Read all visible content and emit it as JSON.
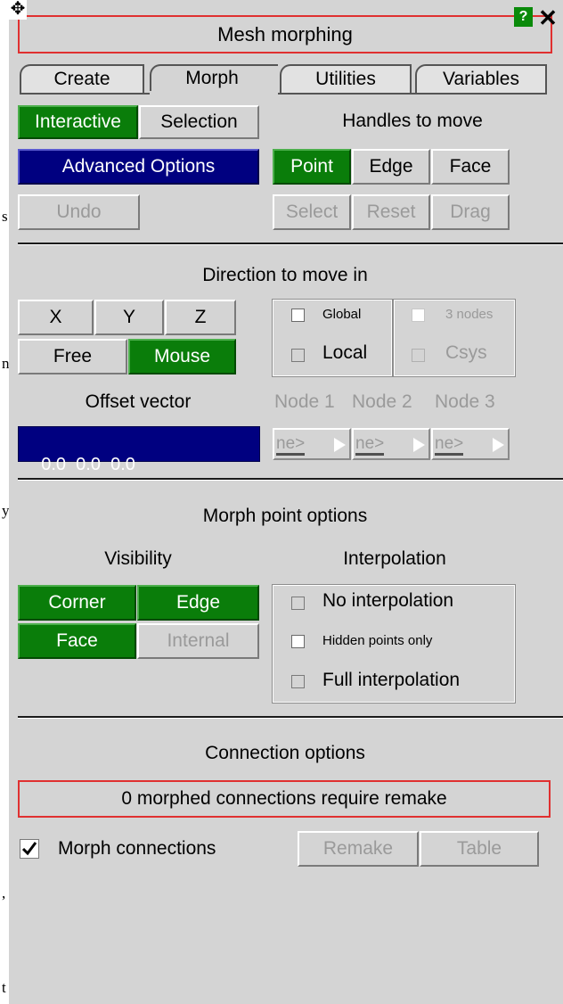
{
  "left_edge_chars": [
    "s",
    "n.",
    "y",
    ",",
    "t"
  ],
  "title": {
    "text": "Mesh morphing",
    "help_label": "?",
    "close_label": "✕",
    "move_label": "✥"
  },
  "tabs": [
    {
      "label": "Create",
      "active": false
    },
    {
      "label": "Morph",
      "active": true
    },
    {
      "label": "Utilities",
      "active": false
    },
    {
      "label": "Variables",
      "active": false
    }
  ],
  "mode": {
    "interactive_label": "Interactive",
    "selection_label": "Selection",
    "advanced_options_label": "Advanced Options",
    "undo_label": "Undo"
  },
  "handles": {
    "title": "Handles to move",
    "point_label": "Point",
    "edge_label": "Edge",
    "face_label": "Face",
    "select_label": "Select",
    "reset_label": "Reset",
    "drag_label": "Drag"
  },
  "direction": {
    "title": "Direction to move in",
    "x_label": "X",
    "y_label": "Y",
    "z_label": "Z",
    "free_label": "Free",
    "mouse_label": "Mouse",
    "global_label": "Global",
    "three_nodes_label": "3 nodes",
    "local_label": "Local",
    "csys_label": "Csys",
    "offset_vector_label": "Offset vector",
    "offset_vector_value": "0.0  0.0  0.0",
    "node1_label": "Node 1",
    "node2_label": "Node 2",
    "node3_label": "Node 3",
    "node_button_text": "ne>"
  },
  "morph_point": {
    "title": "Morph point options",
    "visibility_label": "Visibility",
    "interpolation_label": "Interpolation",
    "corner_label": "Corner",
    "edge_label": "Edge",
    "face_label": "Face",
    "internal_label": "Internal",
    "no_interpolation_label": "No interpolation",
    "hidden_points_only_label": "Hidden points only",
    "full_interpolation_label": "Full interpolation"
  },
  "connection": {
    "title": "Connection options",
    "status_text": "0 morphed connections require remake",
    "morph_connections_label": "Morph connections",
    "morph_connections_checked": true,
    "remake_label": "Remake",
    "table_label": "Table"
  },
  "colors": {
    "active_green": "#0a7d0a",
    "navy": "#000080",
    "panel_gray": "#d4d4d4",
    "title_border_red": "#e03030"
  }
}
